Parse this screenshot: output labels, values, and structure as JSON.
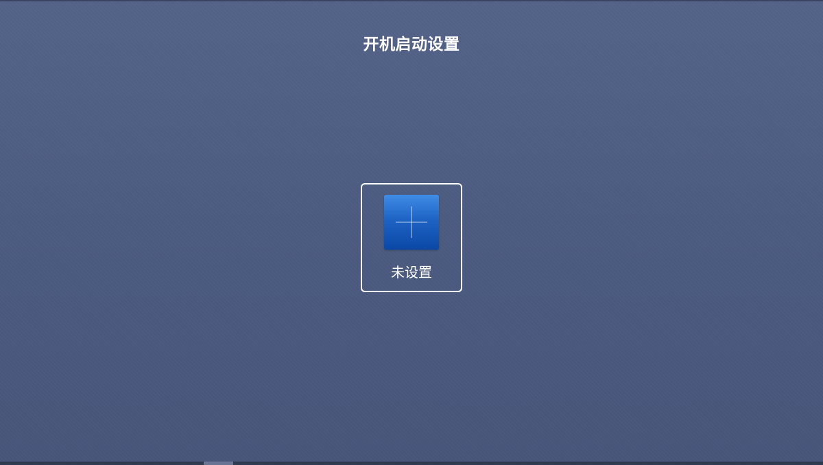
{
  "page": {
    "title": "开机启动设置"
  },
  "startup_slot": {
    "label": "未设置",
    "icon": "plus-icon",
    "state": "focused"
  },
  "colors": {
    "background": "#4d5b80",
    "tile_gradient_top": "#3f8de6",
    "tile_gradient_bottom": "#0b48a6",
    "focus_border": "#ffffff",
    "text": "#ffffff"
  }
}
